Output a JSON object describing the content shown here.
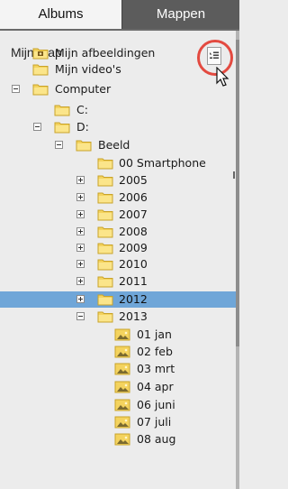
{
  "tabs": {
    "albums": "Albums",
    "mappen": "Mappen"
  },
  "panel": {
    "title": "Mijn map"
  },
  "tree": [
    {
      "id": "mijn-afbeeldingen",
      "label": "Mijn afbeeldingen",
      "icon": "picture-folder-icon",
      "expander": "none",
      "selected": false
    },
    {
      "id": "mijn-videos",
      "label": "Mijn video's",
      "icon": "folder-icon",
      "expander": "none",
      "selected": false
    },
    {
      "id": "computer",
      "label": "Computer",
      "icon": "folder-icon",
      "expander": "minus",
      "selected": false
    },
    {
      "id": "c",
      "label": "C:",
      "icon": "folder-icon",
      "expander": "none",
      "selected": false
    },
    {
      "id": "d",
      "label": "D:",
      "icon": "folder-icon",
      "expander": "minus",
      "selected": false
    },
    {
      "id": "beeld",
      "label": "Beeld",
      "icon": "folder-icon",
      "expander": "minus",
      "selected": false
    },
    {
      "id": "00-smartphone",
      "label": "00 Smartphone",
      "icon": "folder-icon",
      "expander": "none",
      "selected": false
    },
    {
      "id": "2005",
      "label": "2005",
      "icon": "folder-icon",
      "expander": "plus",
      "selected": false
    },
    {
      "id": "2006",
      "label": "2006",
      "icon": "folder-icon",
      "expander": "plus",
      "selected": false
    },
    {
      "id": "2007",
      "label": "2007",
      "icon": "folder-icon",
      "expander": "plus",
      "selected": false
    },
    {
      "id": "2008",
      "label": "2008",
      "icon": "folder-icon",
      "expander": "plus",
      "selected": false
    },
    {
      "id": "2009",
      "label": "2009",
      "icon": "folder-icon",
      "expander": "plus",
      "selected": false
    },
    {
      "id": "2010",
      "label": "2010",
      "icon": "folder-icon",
      "expander": "plus",
      "selected": false
    },
    {
      "id": "2011",
      "label": "2011",
      "icon": "folder-icon",
      "expander": "plus",
      "selected": false
    },
    {
      "id": "2012",
      "label": "2012",
      "icon": "folder-icon",
      "expander": "plus",
      "selected": true
    },
    {
      "id": "2013",
      "label": "2013",
      "icon": "folder-icon",
      "expander": "minus",
      "selected": false
    },
    {
      "id": "01-jan",
      "label": "01 jan",
      "icon": "photo-folder-icon",
      "expander": "none",
      "selected": false
    },
    {
      "id": "02-feb",
      "label": "02 feb",
      "icon": "photo-folder-icon",
      "expander": "none",
      "selected": false
    },
    {
      "id": "03-mrt",
      "label": "03 mrt",
      "icon": "photo-folder-icon",
      "expander": "none",
      "selected": false
    },
    {
      "id": "04-apr",
      "label": "04 apr",
      "icon": "photo-folder-icon",
      "expander": "none",
      "selected": false
    },
    {
      "id": "06-juni",
      "label": "06 juni",
      "icon": "photo-folder-icon",
      "expander": "none",
      "selected": false
    },
    {
      "id": "07-juli",
      "label": "07 juli",
      "icon": "photo-folder-icon",
      "expander": "none",
      "selected": false
    },
    {
      "id": "08-aug",
      "label": "08 aug",
      "icon": "photo-folder-icon",
      "expander": "none",
      "selected": false
    }
  ],
  "colors": {
    "selection": "#6fa6d8",
    "folder": "#f4d35e",
    "active_tab": "#5c5c5c",
    "highlight_circle": "#e34a40"
  }
}
